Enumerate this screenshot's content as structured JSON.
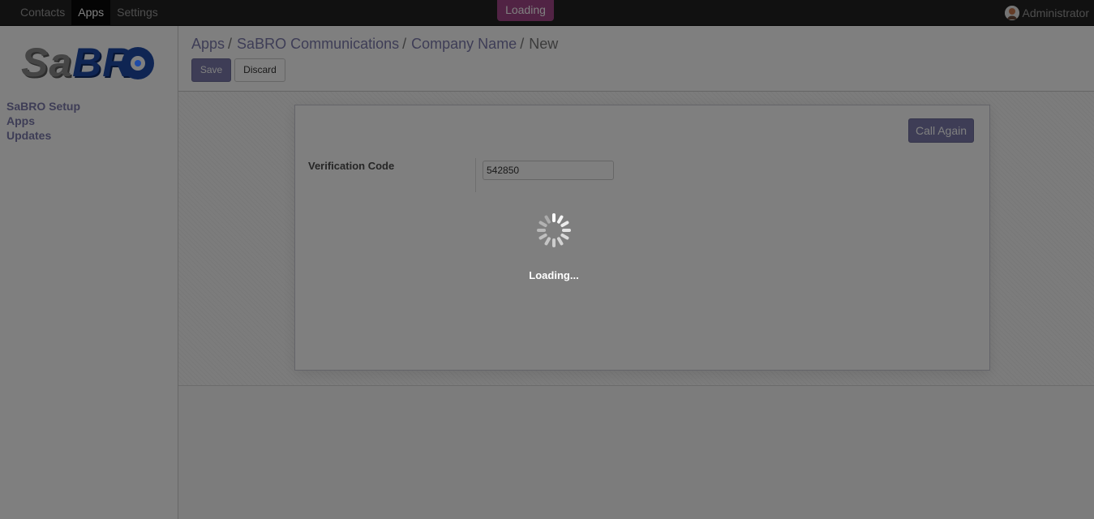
{
  "navbar": {
    "menu": [
      {
        "label": "Contacts",
        "active": false
      },
      {
        "label": "Apps",
        "active": true
      },
      {
        "label": "Settings",
        "active": false
      }
    ],
    "loading_badge": "Loading",
    "user_name": "Administrator",
    "user_icon": "user-avatar-icon"
  },
  "sidebar": {
    "logo": {
      "part1": "Sa",
      "part2": "BR",
      "part3": "O"
    },
    "items": [
      {
        "label": "SaBRO Setup"
      },
      {
        "label": "Apps"
      },
      {
        "label": "Updates"
      }
    ]
  },
  "control_panel": {
    "breadcrumbs": [
      "Apps",
      "SaBRO Communications",
      "Company Name"
    ],
    "current": "New",
    "save_label": "Save",
    "discard_label": "Discard"
  },
  "form": {
    "call_again_label": "Call Again",
    "verification_label": "Verification Code",
    "verification_value": "542850"
  },
  "overlay": {
    "loading_text": "Loading..."
  },
  "colors": {
    "primary": "#7c7bad",
    "navbar": "#222222",
    "loading_badge": "#a24689",
    "logo_blue": "#1f4ba7"
  }
}
